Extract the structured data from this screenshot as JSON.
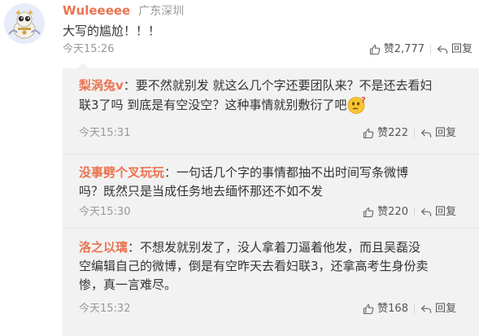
{
  "comment": {
    "username": "Wuleeeee",
    "location": "广东深圳",
    "text": "大写的尴尬！！！",
    "time": "今天15:26",
    "likes": "赞2,777",
    "reply_label": "回复"
  },
  "replies": [
    {
      "username": "梨涡兔v",
      "text_line1": "：要不然就别发 就这么几个字还要团队来？不是还去看妇",
      "text_line2": "联3了吗 到底是有空没空？这种事情就别敷衍了吧",
      "time": "今天15:31",
      "likes": "赞222",
      "reply_label": "回复"
    },
    {
      "username": "没事劈个叉玩玩",
      "text_line1": "：一句话几个字的事情都抽不出时间写条微博",
      "text_line2": "吗？既然只是当成任务地去缅怀那还不如不发",
      "time": "今天15:30",
      "likes": "赞220",
      "reply_label": "回复"
    },
    {
      "username": "洛之以璃",
      "text_line1": "：不想发就别发了，没人拿着刀逼着他发，而且吴磊没",
      "text_line2": "空编辑自己的微博，倒是有空昨天去看妇联3，还拿高考生身份卖",
      "text_line3": "惨，真一言难尽。",
      "time": "今天15:32",
      "likes": "赞168",
      "reply_label": "回复"
    }
  ],
  "icons": {
    "like": "thumbs-up-icon",
    "reply": "reply-arrow-icon",
    "emoji": "thinking-face-emoji-icon"
  },
  "colors": {
    "username": "#eb7350",
    "text": "#333333",
    "meta": "#999999",
    "reply_bg": "#f2f2f2"
  }
}
